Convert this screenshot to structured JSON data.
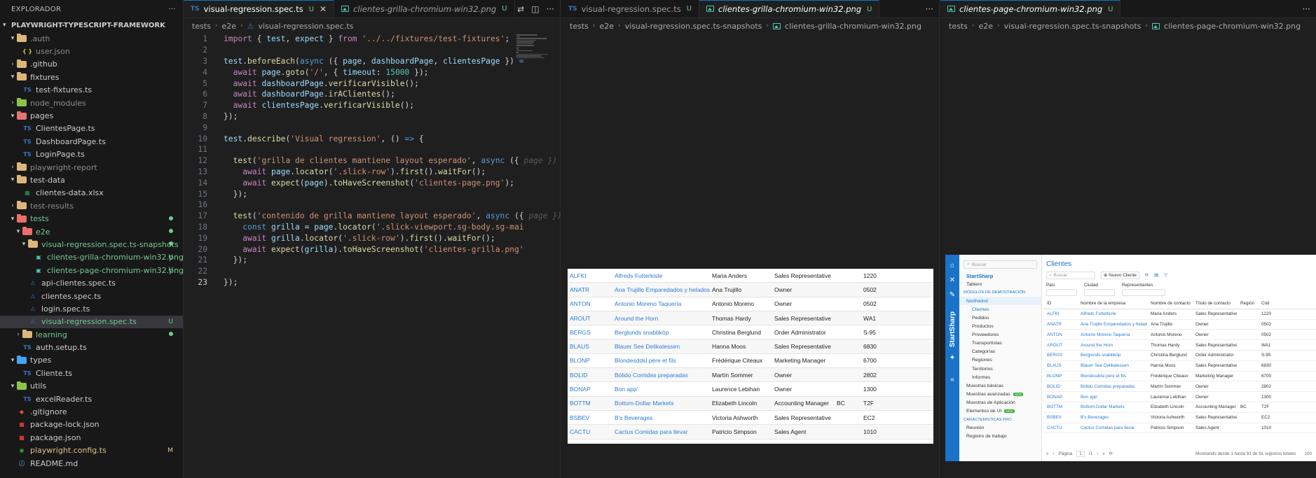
{
  "explorer": {
    "title": "EXPLORADOR",
    "more": "···",
    "section": "PLAYWRIGHT-TYPESCRIPT-FRAMEWORK",
    "items": [
      {
        "label": ".auth",
        "kind": "folder",
        "open": true,
        "depth": 1,
        "color": "#dcb67a",
        "style": "dim"
      },
      {
        "label": "user.json",
        "kind": "json",
        "depth": 2,
        "style": "dim"
      },
      {
        "label": ".github",
        "kind": "folder",
        "open": false,
        "depth": 1,
        "color": "#dcb67a"
      },
      {
        "label": "fixtures",
        "kind": "folder",
        "open": true,
        "depth": 1,
        "color": "#dcb67a"
      },
      {
        "label": "test-fixtures.ts",
        "kind": "ts",
        "depth": 2
      },
      {
        "label": "node_modules",
        "kind": "folder",
        "open": false,
        "depth": 1,
        "color": "#8bc34a",
        "style": "dim"
      },
      {
        "label": "pages",
        "kind": "folder",
        "open": true,
        "depth": 1,
        "color": "#e57373"
      },
      {
        "label": "ClientesPage.ts",
        "kind": "ts",
        "depth": 2
      },
      {
        "label": "DashboardPage.ts",
        "kind": "ts",
        "depth": 2
      },
      {
        "label": "LoginPage.ts",
        "kind": "ts",
        "depth": 2
      },
      {
        "label": "playwright-report",
        "kind": "folder",
        "open": false,
        "depth": 1,
        "color": "#dcb67a",
        "style": "dim"
      },
      {
        "label": "test-data",
        "kind": "folder",
        "open": true,
        "depth": 1,
        "color": "#dcb67a"
      },
      {
        "label": "clientes-data.xlsx",
        "kind": "xlsx",
        "depth": 2
      },
      {
        "label": "test-results",
        "kind": "folder",
        "open": false,
        "depth": 1,
        "color": "#dcb67a",
        "style": "dim"
      },
      {
        "label": "tests",
        "kind": "folder",
        "open": true,
        "depth": 1,
        "color": "#ef6c6c",
        "style": "green",
        "deco": "dot"
      },
      {
        "label": "e2e",
        "kind": "folder",
        "open": true,
        "depth": 2,
        "color": "#ef6c6c",
        "style": "green",
        "deco": "dot"
      },
      {
        "label": "visual-regression.spec.ts-snapshots",
        "kind": "folder",
        "open": true,
        "depth": 3,
        "color": "#dcb67a",
        "style": "green",
        "deco": "dot"
      },
      {
        "label": "clientes-grilla-chromium-win32.png",
        "kind": "png",
        "depth": 4,
        "style": "green",
        "deco": "U"
      },
      {
        "label": "clientes-page-chromium-win32.png",
        "kind": "png",
        "depth": 4,
        "style": "green",
        "deco": "U"
      },
      {
        "label": "api-clientes.spec.ts",
        "kind": "spec",
        "depth": 3
      },
      {
        "label": "clientes.spec.ts",
        "kind": "spec",
        "depth": 3
      },
      {
        "label": "login.spec.ts",
        "kind": "spec",
        "depth": 3
      },
      {
        "label": "visual-regression.spec.ts",
        "kind": "spec",
        "depth": 3,
        "style": "green",
        "deco": "U"
      },
      {
        "label": "learning",
        "kind": "folder",
        "open": false,
        "depth": 2,
        "color": "#dcb67a",
        "style": "green",
        "deco": "dot"
      },
      {
        "label": "auth.setup.ts",
        "kind": "ts",
        "depth": 2
      },
      {
        "label": "types",
        "kind": "folder",
        "open": true,
        "depth": 1,
        "color": "#42a5f5"
      },
      {
        "label": "Cliente.ts",
        "kind": "ts",
        "depth": 2
      },
      {
        "label": "utils",
        "kind": "folder",
        "open": true,
        "depth": 1,
        "color": "#8bc34a"
      },
      {
        "label": "excelReader.ts",
        "kind": "ts",
        "depth": 2
      },
      {
        "label": ".gitignore",
        "kind": "git",
        "depth": 1
      },
      {
        "label": "package-lock.json",
        "kind": "npm",
        "depth": 1
      },
      {
        "label": "package.json",
        "kind": "npm",
        "depth": 1
      },
      {
        "label": "playwright.config.ts",
        "kind": "pw",
        "depth": 1,
        "style": "mod",
        "deco": "M"
      },
      {
        "label": "README.md",
        "kind": "md",
        "depth": 1
      }
    ]
  },
  "group1": {
    "tabs": [
      {
        "icon": "TS",
        "name": "visual-regression.spec.ts",
        "mark": "U",
        "active": true,
        "close": "✕"
      },
      {
        "icon": "img",
        "name": "clientes-grilla-chromium-win32.png",
        "mark": "U",
        "preview": true
      }
    ],
    "crumbs": [
      "tests",
      "e2e",
      "visual-regression.spec.ts"
    ],
    "lines": [
      {
        "n": "1",
        "html": "<span class=\"kw\">import</span> <span class=\"pun\">{</span> <span class=\"var\">test</span><span class=\"pun\">,</span> <span class=\"var\">expect</span> <span class=\"pun\">}</span> <span class=\"kw\">from</span> <span class=\"str\">'../../fixtures/test-fixtures'</span><span class=\"pun\">;</span>"
      },
      {
        "n": "2",
        "html": ""
      },
      {
        "n": "3",
        "html": "<span class=\"var\">test</span>.<span class=\"fn\">beforeEach</span>(<span class=\"kw2\">async</span> ({ <span class=\"var\">page</span>, <span class=\"var\">dashboardPage</span>, <span class=\"var\">clientesPage</span> }) <span class=\"kw2\">=</span>"
      },
      {
        "n": "4",
        "html": "  <span class=\"kw\">await</span> <span class=\"var\">page</span>.<span class=\"fn\">goto</span>(<span class=\"str\">'/'</span>, { <span class=\"var\">timeout</span>: <span class=\"cls\">15000</span> });"
      },
      {
        "n": "5",
        "html": "  <span class=\"kw\">await</span> <span class=\"var\">dashboardPage</span>.<span class=\"fn\">verificarVisible</span>();"
      },
      {
        "n": "6",
        "html": "  <span class=\"kw\">await</span> <span class=\"var\">dashboardPage</span>.<span class=\"fn\">irAClientes</span>();"
      },
      {
        "n": "7",
        "html": "  <span class=\"kw\">await</span> <span class=\"var\">clientesPage</span>.<span class=\"fn\">verificarVisible</span>();"
      },
      {
        "n": "8",
        "html": "});"
      },
      {
        "n": "9",
        "html": ""
      },
      {
        "n": "10",
        "html": "<span class=\"var\">test</span>.<span class=\"fn\">describe</span>(<span class=\"str\">'Visual regression'</span>, () <span class=\"kw2\">=&gt;</span> {"
      },
      {
        "n": "11",
        "html": ""
      },
      {
        "n": "12",
        "html": "  <span class=\"fn\">test</span>(<span class=\"str\">'grilla de clientes mantiene layout esperado'</span>, <span class=\"kw2\">async</span> ({ <span class=\"ghost\">page }) =</span>"
      },
      {
        "n": "13",
        "html": "    <span class=\"kw\">await</span> <span class=\"var\">page</span>.<span class=\"fn\">locator</span>(<span class=\"str\">'.slick-row'</span>).<span class=\"fn\">first</span>().<span class=\"fn\">waitFor</span>();"
      },
      {
        "n": "14",
        "html": "    <span class=\"kw\">await</span> <span class=\"fn\">expect</span>(<span class=\"var\">page</span>).<span class=\"fn\">toHaveScreenshot</span>(<span class=\"str\">'clientes-page.png'</span>);"
      },
      {
        "n": "15",
        "html": "  });"
      },
      {
        "n": "16",
        "html": ""
      },
      {
        "n": "17",
        "html": "  <span class=\"fn\">test</span>(<span class=\"str\">'contenido de grilla mantiene layout esperado'</span>, <span class=\"kw2\">async</span> ({ <span class=\"ghost\">page }) =</span>"
      },
      {
        "n": "18",
        "html": "    <span class=\"kw2\">const</span> <span class=\"var\">grilla</span> = <span class=\"var\">page</span>.<span class=\"fn\">locator</span>(<span class=\"str\">'.slick-viewport.sg-body.sg-mai</span>"
      },
      {
        "n": "19",
        "html": "    <span class=\"kw\">await</span> <span class=\"var\">grilla</span>.<span class=\"fn\">locator</span>(<span class=\"str\">'.slick-row'</span>).<span class=\"fn\">first</span>().<span class=\"fn\">waitFor</span>();"
      },
      {
        "n": "20",
        "html": "    <span class=\"kw\">await</span> <span class=\"fn\">expect</span>(<span class=\"var\">grilla</span>).<span class=\"fn\">toHaveScreenshot</span>(<span class=\"str\">'clientes-grilla.png'</span>"
      },
      {
        "n": "21",
        "html": "  });"
      },
      {
        "n": "22",
        "html": ""
      },
      {
        "n": "23",
        "html": "});",
        "current": true
      }
    ]
  },
  "group2": {
    "tabs": [
      {
        "icon": "TS",
        "name": "visual-regression.spec.ts",
        "mark": "U"
      },
      {
        "icon": "img",
        "name": "clientes-grilla-chromium-win32.png",
        "mark": "U",
        "active": true,
        "preview": true
      }
    ],
    "crumbs": [
      "tests",
      "e2e",
      "visual-regression.spec.ts-snapshots",
      "clientes-grilla-chromium-win32.png"
    ],
    "grid_rows": [
      [
        "ALFKI",
        "Alfreds Futterkiste",
        "Maria Anders",
        "Sales Representative",
        "",
        "1220"
      ],
      [
        "ANATR",
        "Ana Trujillo Emparedados y helados",
        "Ana Trujillo",
        "Owner",
        "",
        "0502"
      ],
      [
        "ANTON",
        "Antonio Moreno Taquería",
        "Antonio Moreno",
        "Owner",
        "",
        "0502"
      ],
      [
        "AROUT",
        "Around the Horn",
        "Thomas Hardy",
        "Sales Representative",
        "",
        "WA1"
      ],
      [
        "BERGS",
        "Berglunds snabbköp",
        "Christina Berglund",
        "Order Administrator",
        "",
        "S-95"
      ],
      [
        "BLAUS",
        "Blauer See Delikatessen",
        "Hanna Moos",
        "Sales Representative",
        "",
        "6830"
      ],
      [
        "BLONP",
        "Blondesddsl père et fils",
        "Frédérique Citeaux",
        "Marketing Manager",
        "",
        "6700"
      ],
      [
        "BOLID",
        "Bólido Comidas preparadas",
        "Martín Sommer",
        "Owner",
        "",
        "2802"
      ],
      [
        "BONAP",
        "Bon app'",
        "Laurence Lebihan",
        "Owner",
        "",
        "1300"
      ],
      [
        "BOTTM",
        "Bottom-Dollar Markets",
        "Elizabeth Lincoln",
        "Accounting Manager",
        "BC",
        "T2F"
      ],
      [
        "BSBEV",
        "B's Beverages",
        "Victoria Ashworth",
        "Sales Representative",
        "",
        "EC2"
      ],
      [
        "CACTU",
        "Cactus Comidas para llevar",
        "Patricio Simpson",
        "Sales Agent",
        "",
        "1010"
      ]
    ]
  },
  "group3": {
    "tabs": [
      {
        "icon": "img",
        "name": "clientes-page-chromium-win32.png",
        "mark": "U",
        "active": true,
        "preview": true
      }
    ],
    "crumbs": [
      "tests",
      "e2e",
      "visual-regression.spec.ts-snapshots",
      "clientes-page-chromium-win32.png"
    ],
    "page": {
      "brand": "StartSharp",
      "search_placeholder": "Buscar",
      "nav": [
        "Tablero",
        "MÓDULOS DE DEMOSTRACIÓN",
        "Northwind",
        "Clientes",
        "Pedidos",
        "Productos",
        "Proveedores",
        "Transportistas",
        "Categorías",
        "Regiones",
        "Territorios",
        "Informes",
        "Muestras básicas",
        "Muestras avanzadas",
        "Muestras de Aplicación",
        "Elementos de UI",
        "CARACTERÍSTICAS PRO",
        "Reunión",
        "Registro de trabajo"
      ],
      "new_badge": "NEW",
      "title": "Clientes",
      "toolbar_search": "Buscar",
      "new_client": "Nuevo Cliente",
      "filters": [
        "País",
        "Ciudad",
        "Representantes"
      ],
      "columns": [
        "ID",
        "Nombre de la empresa",
        "Nombre de contacto",
        "Título de contacto",
        "Región",
        "Cód"
      ],
      "rows": [
        [
          "ALFKI",
          "Alfreds Futterkiste",
          "Maria Anders",
          "Sales Representative",
          "",
          "1220"
        ],
        [
          "ANATR",
          "Ana Trujillo Emparedados y helados",
          "Ana Trujillo",
          "Owner",
          "",
          "0502"
        ],
        [
          "ANTON",
          "Antonio Moreno Taquería",
          "Antonio Moreno",
          "Owner",
          "",
          "0502"
        ],
        [
          "AROUT",
          "Around the Horn",
          "Thomas Hardy",
          "Sales Representative",
          "",
          "WA1"
        ],
        [
          "BERGS",
          "Berglunds snabbköp",
          "Christina Berglund",
          "Order Administrator",
          "",
          "S-95"
        ],
        [
          "BLAUS",
          "Blauer See Delikatessen",
          "Hanna Moos",
          "Sales Representative",
          "",
          "6830"
        ],
        [
          "BLONP",
          "Blondesddsl père et fils",
          "Frédérique Citeaux",
          "Marketing Manager",
          "",
          "6700"
        ],
        [
          "BOLID",
          "Bólido Comidas preparadas",
          "Martín Sommer",
          "Owner",
          "",
          "2802"
        ],
        [
          "BONAP",
          "Bon app'",
          "Laurence Lebihan",
          "Owner",
          "",
          "1300"
        ],
        [
          "BOTTM",
          "Bottom-Dollar Markets",
          "Elizabeth Lincoln",
          "Accounting Manager",
          "BC",
          "T2F"
        ],
        [
          "BSBEV",
          "B's Beverages",
          "Victoria Ashworth",
          "Sales Representative",
          "",
          "EC2"
        ],
        [
          "CACTU",
          "Cactus Comidas para llevar",
          "Patricio Simpson",
          "Sales Agent",
          "",
          "1010"
        ]
      ],
      "pager_label": "Página",
      "pager_page": "1",
      "pager_of": "/1",
      "pager_status": "Mostrando desde 1 hasta 91 de 91 registros totales",
      "page_size": "100"
    }
  }
}
